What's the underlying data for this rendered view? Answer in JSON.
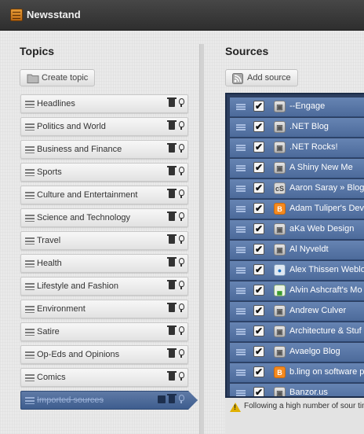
{
  "window": {
    "title": "Newsstand",
    "app_icon": "newsstand-icon"
  },
  "topics": {
    "heading": "Topics",
    "create_button": "Create topic",
    "create_icon": "folder-icon",
    "items": [
      {
        "label": "Headlines"
      },
      {
        "label": "Politics and World"
      },
      {
        "label": "Business and Finance"
      },
      {
        "label": "Sports"
      },
      {
        "label": "Culture and Entertainment"
      },
      {
        "label": "Science and Technology"
      },
      {
        "label": "Travel"
      },
      {
        "label": "Health"
      },
      {
        "label": "Lifestyle and Fashion"
      },
      {
        "label": "Environment"
      },
      {
        "label": "Satire"
      },
      {
        "label": "Op-Eds and Opinions"
      },
      {
        "label": "Comics"
      },
      {
        "label": "Imported sources",
        "selected": true
      }
    ]
  },
  "sources": {
    "heading": "Sources",
    "add_button": "Add source",
    "add_icon": "rss-icon",
    "items": [
      {
        "label": "--Engage",
        "checked": true,
        "icon": "generic"
      },
      {
        "label": ".NET Blog",
        "checked": true,
        "icon": "generic"
      },
      {
        "label": ".NET Rocks!",
        "checked": true,
        "icon": "generic"
      },
      {
        "label": "A Shiny New Me",
        "checked": true,
        "icon": "generic"
      },
      {
        "label": "Aaron Saray » Blog",
        "checked": true,
        "icon": "cs"
      },
      {
        "label": "Adam Tuliper's Dev",
        "checked": true,
        "icon": "blogger"
      },
      {
        "label": "aKa Web Design",
        "checked": true,
        "icon": "generic"
      },
      {
        "label": "Al Nyveldt",
        "checked": true,
        "icon": "generic"
      },
      {
        "label": "Alex Thissen Weblo",
        "checked": true,
        "icon": "person"
      },
      {
        "label": "Alvin Ashcraft's Mo",
        "checked": true,
        "icon": "chart"
      },
      {
        "label": "Andrew Culver",
        "checked": true,
        "icon": "generic"
      },
      {
        "label": "Architecture & Stuf",
        "checked": true,
        "icon": "generic"
      },
      {
        "label": "Avaelgo Blog",
        "checked": true,
        "icon": "generic"
      },
      {
        "label": "b.ling on software p",
        "checked": true,
        "icon": "blogger"
      },
      {
        "label": "Banzor.us",
        "checked": true,
        "icon": "generic"
      }
    ],
    "warning": "Following a high number of sour time."
  },
  "colors": {
    "selection": "#4c6a9a",
    "titlebar": "#3a3a3a",
    "warning": "#e0b000"
  }
}
